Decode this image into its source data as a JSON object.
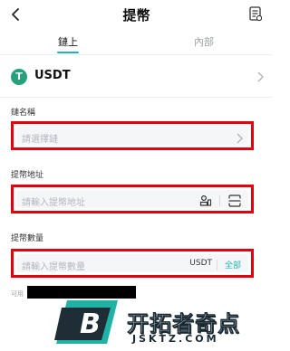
{
  "header": {
    "title": "提幣"
  },
  "tabs": [
    {
      "label": "鏈上",
      "active": true
    },
    {
      "label": "內部",
      "active": false
    }
  ],
  "coin": {
    "name": "USDT",
    "badge_letter": "T",
    "badge_color": "#26a17b"
  },
  "chain": {
    "label": "鏈名稱",
    "placeholder": "請選擇鏈"
  },
  "address": {
    "label": "提幣地址",
    "placeholder": "請輸入提幣地址"
  },
  "amount": {
    "label": "提幣數量",
    "placeholder": "請輸入提幣數量",
    "unit": "USDT",
    "all_label": "全部"
  },
  "available": {
    "label": "可用"
  },
  "watermark": {
    "letter": "B",
    "name": "开拓者奇点",
    "url": "JSKTZ.COM"
  },
  "colors": {
    "accent": "#22b5b0",
    "highlight_border": "#e3000f"
  }
}
